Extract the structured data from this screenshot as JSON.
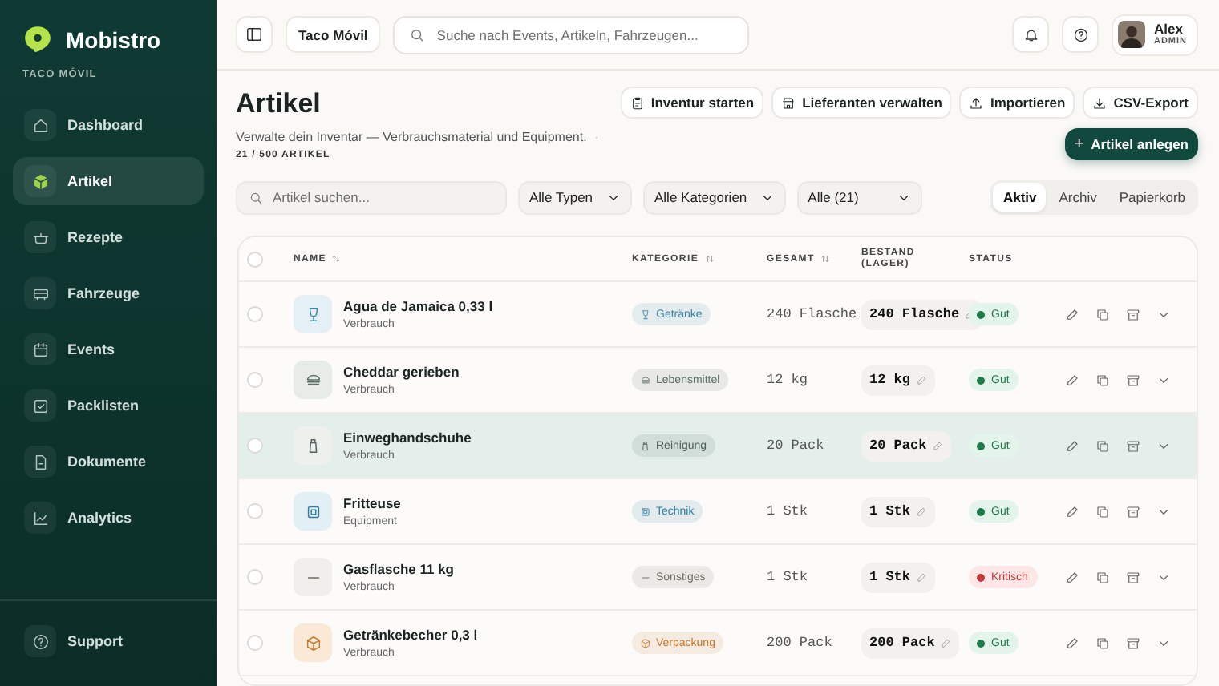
{
  "sidebar": {
    "brand": "Mobistro",
    "workspace": "TACO MÓVIL",
    "items": [
      {
        "label": "Dashboard",
        "kind": "home",
        "selected": false
      },
      {
        "label": "Artikel",
        "kind": "box",
        "selected": true
      },
      {
        "label": "Rezepte",
        "kind": "pot",
        "selected": false
      },
      {
        "label": "Fahrzeuge",
        "kind": "truck",
        "selected": false
      },
      {
        "label": "Events",
        "kind": "calendar",
        "selected": false
      },
      {
        "label": "Packlisten",
        "kind": "check",
        "selected": false
      },
      {
        "label": "Dokumente",
        "kind": "doc",
        "selected": false
      },
      {
        "label": "Analytics",
        "kind": "chart",
        "selected": false
      }
    ],
    "footer": {
      "label": "Support",
      "kind": "help"
    }
  },
  "topbar": {
    "workspace": "Taco Móvil",
    "search": {
      "placeholder": "Suche nach Events, Artikeln, Fahrzeugen..."
    },
    "user": {
      "name": "Alex",
      "role": "ADMIN"
    }
  },
  "header": {
    "title": "Artikel",
    "subtitle": "Verwalte dein Inventar — Verbrauchsmaterial und Equipment.",
    "subtitle_mark": "·",
    "count": "21 / 500 ARTIKEL",
    "actions": [
      {
        "label": "Inventur starten",
        "kind": "clipboard"
      },
      {
        "label": "Lieferanten verwalten",
        "kind": "store"
      },
      {
        "label": "Importieren",
        "kind": "upload"
      },
      {
        "label": "CSV-Export",
        "kind": "download"
      }
    ],
    "primary": {
      "label": "Artikel anlegen",
      "icon": "+"
    }
  },
  "filters": {
    "search": {
      "placeholder": "Artikel suchen..."
    },
    "selects": [
      "Alle Typen",
      "Alle Kategorien",
      "Alle (21)"
    ],
    "views": [
      {
        "label": "Aktiv",
        "selected": true
      },
      {
        "label": "Archiv",
        "selected": false
      },
      {
        "label": "Papierkorb",
        "selected": false
      }
    ]
  },
  "table": {
    "columns": [
      {
        "label": "NAME",
        "sortable": true
      },
      {
        "label": "KATEGORIE",
        "sortable": true
      },
      {
        "label": "GESAMT",
        "sortable": true
      },
      {
        "label": "BESTAND (LAGER)",
        "sortable": false
      },
      {
        "label": "STATUS",
        "sortable": false
      }
    ],
    "header_checked": false,
    "rows": [
      {
        "name": "Agua de Jamaica 0,33 l",
        "type": "Verbrauch",
        "category": {
          "label": "Getränke",
          "kind": "drink",
          "color": "#3b86a8"
        },
        "total": "240 Flasche",
        "stock": "240 Flasche",
        "status": {
          "label": "Gut",
          "kind": "good"
        },
        "checked": false,
        "selected": false
      },
      {
        "name": "Cheddar gerieben",
        "type": "Verbrauch",
        "category": {
          "label": "Lebensmittel",
          "kind": "food",
          "color": "#5b6f66"
        },
        "total": "12 kg",
        "stock": "12 kg",
        "status": {
          "label": "Gut",
          "kind": "good"
        },
        "checked": false,
        "selected": false
      },
      {
        "name": "Einweghandschuhe",
        "type": "Verbrauch",
        "category": {
          "label": "Reinigung",
          "kind": "cleaning",
          "color": "#4f5f5a"
        },
        "total": "20 Pack",
        "stock": "20 Pack",
        "status": {
          "label": "Gut",
          "kind": "good"
        },
        "checked": false,
        "selected": true
      },
      {
        "name": "Fritteuse",
        "type": "Equipment",
        "category": {
          "label": "Technik",
          "kind": "tech",
          "color": "#2f7fa6"
        },
        "total": "1 Stk",
        "stock": "1 Stk",
        "status": {
          "label": "Gut",
          "kind": "good"
        },
        "checked": false,
        "selected": false
      },
      {
        "name": "Gasflasche 11 kg",
        "type": "Verbrauch",
        "category": {
          "label": "Sonstiges",
          "kind": "misc",
          "color": "#6f6a62"
        },
        "total": "1 Stk",
        "stock": "1 Stk",
        "status": {
          "label": "Kritisch",
          "kind": "critical"
        },
        "checked": false,
        "selected": false
      },
      {
        "name": "Getränkebecher 0,3 l",
        "type": "Verbrauch",
        "category": {
          "label": "Verpackung",
          "kind": "pack",
          "color": "#c9792e"
        },
        "total": "200 Pack",
        "stock": "200 Pack",
        "status": {
          "label": "Gut",
          "kind": "good"
        },
        "checked": false,
        "selected": false
      }
    ]
  }
}
